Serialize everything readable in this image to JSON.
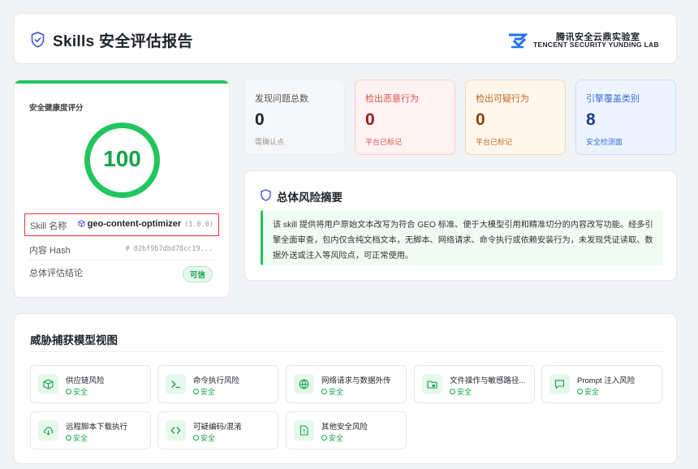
{
  "header": {
    "title": "Skills 安全评估报告",
    "logo_line1": "腾讯安全云鼎实验室",
    "logo_line2": "TENCENT SECURITY YUNDING LAB"
  },
  "score": {
    "label": "安全健康度评分",
    "value": "100",
    "rows": {
      "name_key": "Skill 名称",
      "name_val": "geo-content-optimizer",
      "version": "(1.0.0)",
      "hash_key": "内容 Hash",
      "hash_val": "# 02bf9b7dbd78cc19...",
      "verdict_key": "总体评估结论",
      "verdict_val": "可信"
    }
  },
  "stats": [
    {
      "title": "发现问题总数",
      "value": "0",
      "sub": "需确认点"
    },
    {
      "title": "检出恶意行为",
      "value": "0",
      "sub": "平台已标记"
    },
    {
      "title": "检出可疑行为",
      "value": "0",
      "sub": "平台已标记"
    },
    {
      "title": "引擎覆盖类别",
      "value": "8",
      "sub": "安全检测面"
    }
  ],
  "summary": {
    "title": "总体风险摘要",
    "body": "该 skill 提供将用户原始文本改写为符合 GEO 标准、便于大模型引用和精准切分的内容改写功能。经多引擎全面审查，包内仅含纯文档文本，无脚本、网络请求、命令执行或依赖安装行为，未发现凭证读取、数据外送或注入等风险点，可正常使用。"
  },
  "threat": {
    "title": "威胁捕获模型视图",
    "status_label": "安全",
    "items": [
      {
        "name": "供应链风险",
        "icon": "package-icon"
      },
      {
        "name": "命令执行风险",
        "icon": "terminal-icon"
      },
      {
        "name": "网络请求与数据外传",
        "icon": "globe-icon"
      },
      {
        "name": "文件操作与敏感路径...",
        "icon": "folder-lock-icon"
      },
      {
        "name": "Prompt 注入风险",
        "icon": "message-icon"
      },
      {
        "name": "远程脚本下载执行",
        "icon": "cloud-download-icon"
      },
      {
        "name": "可疑编码/混淆",
        "icon": "code-icon"
      },
      {
        "name": "其他安全风险",
        "icon": "file-alert-icon"
      }
    ]
  },
  "colors": {
    "safe": "#22c55e",
    "danger": "#d9534f",
    "warning": "#c2661c",
    "info": "#3b6fd8"
  }
}
